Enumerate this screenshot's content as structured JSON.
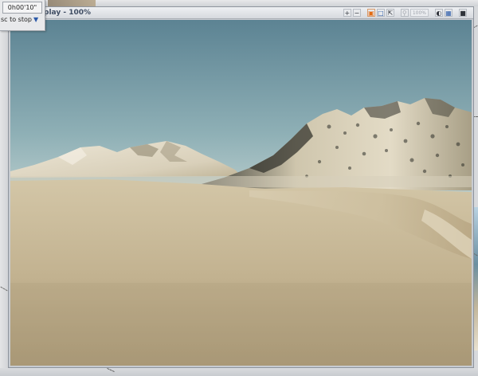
{
  "status_window": {
    "elapsed_time": "0h00'10\"",
    "stop_hint": "sc to stop",
    "filter_icon": "funnel-icon"
  },
  "render_window": {
    "title": "play - 100%",
    "toolbar": {
      "zoom_in_icon": "zoom-in-icon",
      "zoom_out_icon": "zoom-out-icon",
      "crop_icon": "crop-icon",
      "frame_icon": "frame-icon",
      "fit_icon": "fit-icon",
      "magnifier_icon": "magnifier-icon",
      "zoom_level": "100%",
      "contrast_icon": "contrast-icon",
      "save_icon": "save-icon",
      "close_icon": "close-icon"
    }
  },
  "scene": {
    "subject": "rendered terrain",
    "colors": {
      "sky_top": "#5f8594",
      "sky_horizon": "#b9cfd1",
      "sand": "#c8b998",
      "mountain_light": "#e6dfcd",
      "mountain_shadow": "#4a4a40"
    }
  }
}
